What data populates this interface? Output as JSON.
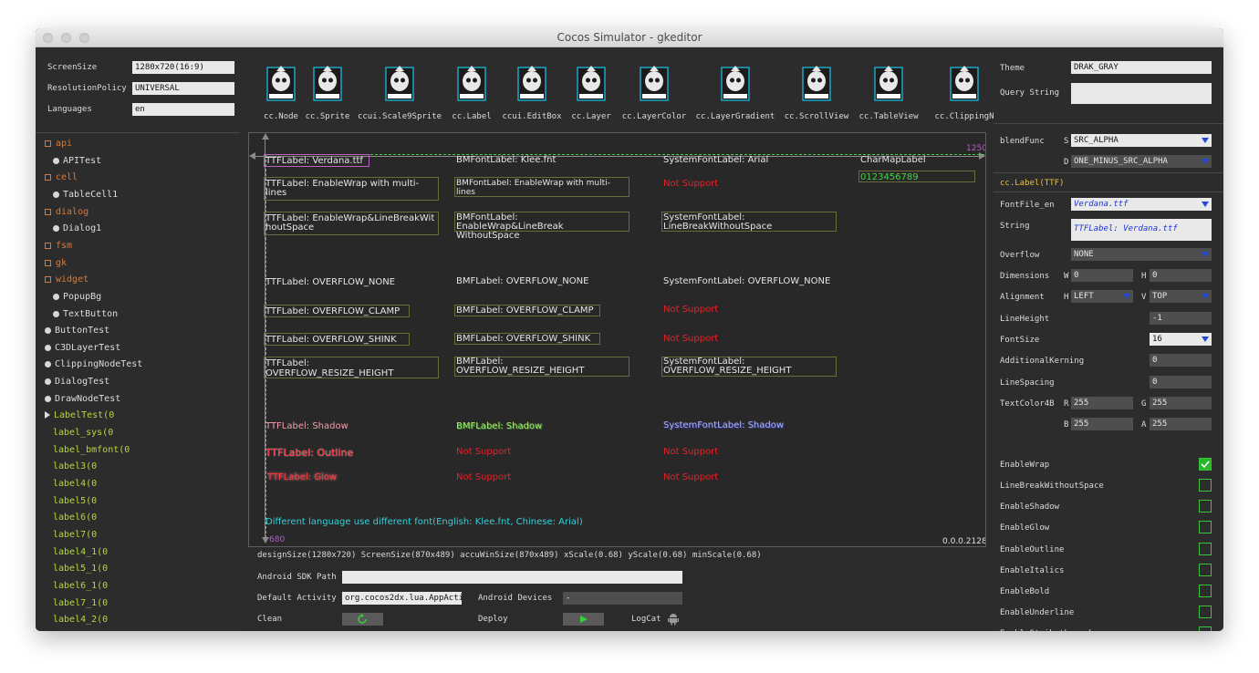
{
  "window": {
    "title": "Cocos Simulator - gkeditor"
  },
  "left_settings": {
    "screen_size": {
      "label": "ScreenSize",
      "value": "1280x720(16:9)"
    },
    "resolution_policy": {
      "label": "ResolutionPolicy",
      "value": "UNIVERSAL"
    },
    "languages": {
      "label": "Languages",
      "value": "en"
    }
  },
  "tree": [
    {
      "text": "api",
      "kind": "folder"
    },
    {
      "text": "APITest",
      "kind": "child"
    },
    {
      "text": "cell",
      "kind": "folder"
    },
    {
      "text": "TableCell1",
      "kind": "child"
    },
    {
      "text": "dialog",
      "kind": "folder"
    },
    {
      "text": "Dialog1",
      "kind": "child"
    },
    {
      "text": "fsm",
      "kind": "folder"
    },
    {
      "text": "gk",
      "kind": "folder"
    },
    {
      "text": "widget",
      "kind": "folder"
    },
    {
      "text": "PopupBg",
      "kind": "child"
    },
    {
      "text": "TextButton",
      "kind": "child"
    },
    {
      "text": "ButtonTest",
      "kind": "item"
    },
    {
      "text": "C3DLayerTest",
      "kind": "item"
    },
    {
      "text": "ClippingNodeTest",
      "kind": "item"
    },
    {
      "text": "DialogTest",
      "kind": "item"
    },
    {
      "text": "DrawNodeTest",
      "kind": "item"
    },
    {
      "text": "LabelTest(0",
      "kind": "expanded"
    },
    {
      "text": "label_sys(0",
      "kind": "leaf"
    },
    {
      "text": "label_bmfont(0",
      "kind": "leaf"
    },
    {
      "text": "label3(0",
      "kind": "leaf"
    },
    {
      "text": "label4(0",
      "kind": "leaf"
    },
    {
      "text": "label5(0",
      "kind": "leaf"
    },
    {
      "text": "label6(0",
      "kind": "leaf"
    },
    {
      "text": "label7(0",
      "kind": "leaf"
    },
    {
      "text": "label4_1(0",
      "kind": "leaf"
    },
    {
      "text": "label5_1(0",
      "kind": "leaf"
    },
    {
      "text": "label6_1(0",
      "kind": "leaf"
    },
    {
      "text": "label7_1(0",
      "kind": "leaf"
    },
    {
      "text": "label4_2(0",
      "kind": "leaf"
    }
  ],
  "widgets": [
    "cc.Node",
    "cc.Sprite",
    "ccui.Scale9Sprite",
    "cc.Label",
    "ccui.EditBox",
    "cc.Layer",
    "cc.LayerColor",
    "cc.LayerGradient",
    "cc.ScrollView",
    "cc.TableView",
    "cc.ClippingN"
  ],
  "canvas": {
    "ruler_x": "1250",
    "ruler_y": "680",
    "version": "0.0.0.2128",
    "footer_text": "Different language use different font(English: Klee.fnt, Chinese: Arial)",
    "r1": {
      "ttf": "TTFLabel: Verdana.ttf",
      "bm": "BMFontLabel: Klee.fnt",
      "sys": "SystemFontLabel: Arial",
      "charmap": "CharMapLabel",
      "charmap_value": "0123456789"
    },
    "r2": {
      "ttf": "TTFLabel: EnableWrap with multi-lines",
      "bm": "BMFontLabel: EnableWrap with multi-lines",
      "sys": "Not Support"
    },
    "r3": {
      "ttf": "TTFLabel: EnableWrap&LineBreakWithoutSpace",
      "bm": "BMFontLabel: EnableWrap&LineBreak WithoutSpace",
      "sys": "SystemFontLabel: LineBreakWithoutSpace"
    },
    "r4": {
      "ttf": "TTFLabel: OVERFLOW_NONE",
      "bm": "BMFLabel: OVERFLOW_NONE",
      "sys": "SystemFontLabel: OVERFLOW_NONE"
    },
    "r5": {
      "ttf": "TTFLabel: OVERFLOW_CLAMP",
      "bm": "BMFLabel: OVERFLOW_CLAMP",
      "sys": "Not Support"
    },
    "r6": {
      "ttf": "TTFLabel: OVERFLOW_SHINK",
      "bm": "BMFLabel: OVERFLOW_SHINK",
      "sys": "Not Support"
    },
    "r7": {
      "ttf": "TTFLabel: OVERFLOW_RESIZE_HEIGHT",
      "bm": "BMFLabel: OVERFLOW_RESIZE_HEIGHT",
      "sys": "SystemFontLabel: OVERFLOW_RESIZE_HEIGHT"
    },
    "r8": {
      "ttf": "TTFLabel:  Shadow",
      "bm": "BMFLabel:  Shadow",
      "sys": "SystemFontLabel: Shadow"
    },
    "r9": {
      "ttf": "TTFLabel:  Outline",
      "bm": "Not Support",
      "sys": "Not Support"
    },
    "r10": {
      "ttf": "TTFLabel:  Glow",
      "bm": "Not Support",
      "sys": "Not Support"
    }
  },
  "status_line": "designSize(1280x720) ScreenSize(870x489) accuWinSize(870x489) xScale(0.68) yScale(0.68) minScale(0.68)",
  "bottom": {
    "sdk_label": "Android SDK Path",
    "sdk_value": "",
    "activity_label": "Default Activity",
    "activity_value": "org.cocos2dx.lua.AppActivity",
    "devices_label": "Android Devices",
    "devices_value": "-",
    "clean_label": "Clean",
    "deploy_label": "Deploy",
    "logcat_label": "LogCat"
  },
  "right": {
    "theme": {
      "label": "Theme",
      "value": "DRAK_GRAY"
    },
    "query": {
      "label": "Query String",
      "value": ""
    },
    "blend": {
      "label": "blendFunc",
      "s_label": "S",
      "s_value": "SRC_ALPHA",
      "d_label": "D",
      "d_value": "ONE_MINUS_SRC_ALPHA"
    },
    "section": "cc.Label(TTF)",
    "fontfile": {
      "label": "FontFile_en",
      "value": "Verdana.ttf"
    },
    "string": {
      "label": "String",
      "value": "TTFLabel: Verdana.ttf"
    },
    "overflow": {
      "label": "Overflow",
      "value": "NONE"
    },
    "dimensions": {
      "label": "Dimensions",
      "w_label": "W",
      "w": "0",
      "h_label": "H",
      "h": "0"
    },
    "alignment": {
      "label": "Alignment",
      "h_label": "H",
      "h": "LEFT",
      "v_label": "V",
      "v": "TOP"
    },
    "lineheight": {
      "label": "LineHeight",
      "value": "-1"
    },
    "fontsize": {
      "label": "FontSize",
      "value": "16"
    },
    "kerning": {
      "label": "AdditionalKerning",
      "value": "0"
    },
    "spacing": {
      "label": "LineSpacing",
      "value": "0"
    },
    "color": {
      "label": "TextColor4B",
      "r_label": "R",
      "r": "255",
      "g_label": "G",
      "g": "255",
      "b_label": "B",
      "b": "255",
      "a_label": "A",
      "a": "255"
    },
    "checks": [
      {
        "label": "EnableWrap",
        "on": true
      },
      {
        "label": "LineBreakWithoutSpace",
        "on": false
      },
      {
        "label": "EnableShadow",
        "on": false
      },
      {
        "label": "EnableGlow",
        "on": false
      },
      {
        "label": "EnableOutline",
        "on": false
      },
      {
        "label": "EnableItalics",
        "on": false
      },
      {
        "label": "EnableBold",
        "on": false
      },
      {
        "label": "EnableUnderline",
        "on": false
      },
      {
        "label": "EnableStrikethrough",
        "on": false
      }
    ]
  },
  "colors": {
    "folder": "#d87a3a",
    "leaf": "#b6d640",
    "section": "#e8c23a",
    "ruler": "#b05ec8",
    "guide": "#46d046",
    "cyan": "#33d0d8",
    "red": "#e8202a",
    "check_on": "#27b827"
  }
}
